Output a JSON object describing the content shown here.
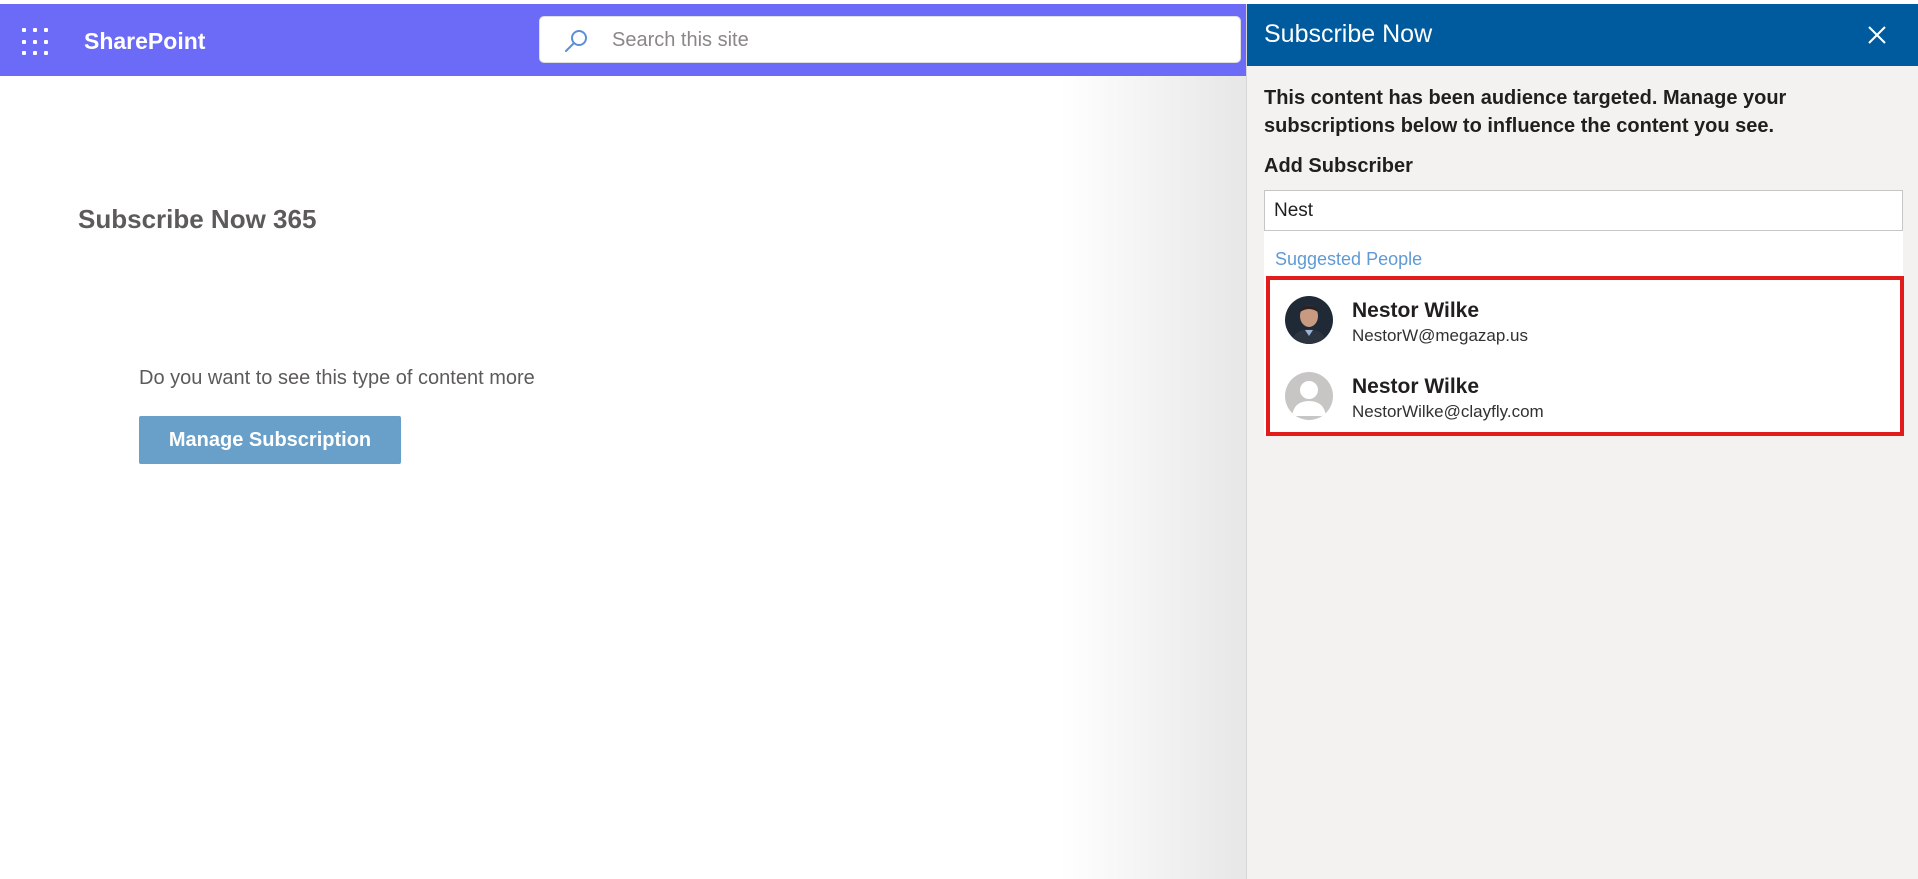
{
  "suite_bar": {
    "app_name": "SharePoint",
    "search_placeholder": "Search this site",
    "color": "#6b6bf8"
  },
  "page": {
    "title": "Subscribe Now 365",
    "question": "Do you want to see this type of content more",
    "manage_button_label": "Manage Subscription",
    "button_color": "#68a0c9"
  },
  "panel": {
    "title": "Subscribe Now",
    "header_color": "#005a9e",
    "description": "This content has been audience targeted. Manage your subscriptions below to influence the content you see.",
    "add_subscriber_label": "Add Subscriber",
    "add_subscriber_value": "Nest",
    "suggested_header": "Suggested People",
    "highlight_color": "#e21b1b",
    "people": [
      {
        "name": "Nestor Wilke",
        "email": "NestorW@megazap.us",
        "avatar": "photo-avatar"
      },
      {
        "name": "Nestor Wilke",
        "email": "NestorWilke@clayfly.com",
        "avatar": "default-person-icon"
      }
    ]
  }
}
